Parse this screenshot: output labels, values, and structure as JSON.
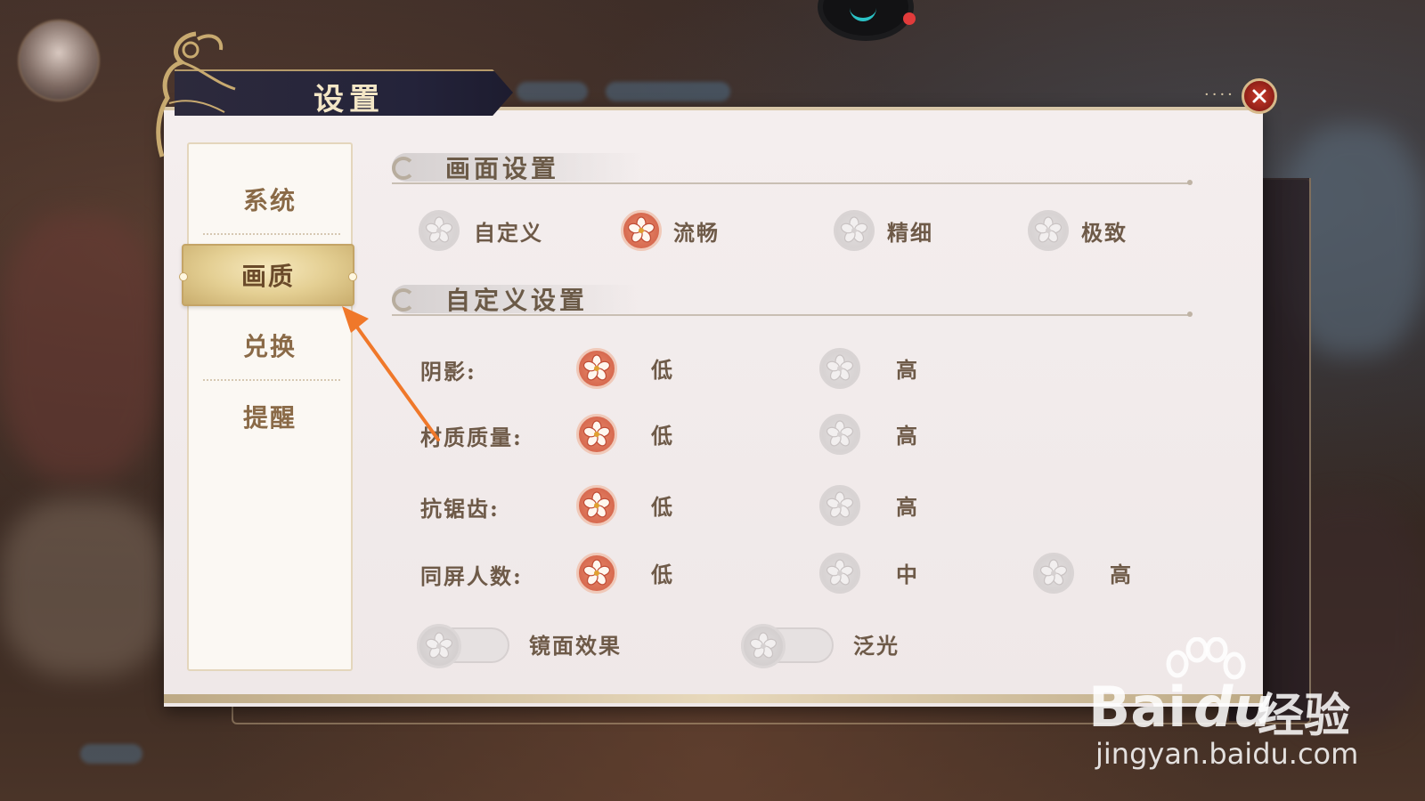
{
  "window": {
    "title": "设置",
    "close_icon": "close-icon",
    "close_dots": "····"
  },
  "sidebar": {
    "items": [
      {
        "label": "系统",
        "active": false
      },
      {
        "label": "画质",
        "active": true
      },
      {
        "label": "兑换",
        "active": false
      },
      {
        "label": "提醒",
        "active": false
      }
    ]
  },
  "picture_settings": {
    "title": "画面设置",
    "options": [
      {
        "label": "自定义",
        "selected": false
      },
      {
        "label": "流畅",
        "selected": true
      },
      {
        "label": "精细",
        "selected": false
      },
      {
        "label": "极致",
        "selected": false
      }
    ]
  },
  "custom_settings": {
    "title": "自定义设置",
    "rows": [
      {
        "label": "阴影:",
        "options": [
          {
            "label": "低",
            "selected": true
          },
          {
            "label": "高",
            "selected": false
          }
        ]
      },
      {
        "label": "材质质量:",
        "options": [
          {
            "label": "低",
            "selected": true
          },
          {
            "label": "高",
            "selected": false
          }
        ]
      },
      {
        "label": "抗锯齿:",
        "options": [
          {
            "label": "低",
            "selected": true
          },
          {
            "label": "高",
            "selected": false
          }
        ]
      },
      {
        "label": "同屏人数:",
        "options": [
          {
            "label": "低",
            "selected": true
          },
          {
            "label": "中",
            "selected": false
          },
          {
            "label": "高",
            "selected": false
          }
        ]
      }
    ],
    "toggles": [
      {
        "label": "镜面效果",
        "on": false
      },
      {
        "label": "泛光",
        "on": false
      }
    ]
  },
  "watermark": {
    "brand": "Bai",
    "brand_du": "du",
    "brand_cn": "经验",
    "url": "jingyan.baidu.com"
  },
  "colors": {
    "accent_selected": "#cf5b43",
    "sidebar_active": "#e4cf93",
    "text_brown": "#6e5a48",
    "close_red": "#c93a2a",
    "annotation_arrow": "#f0782a"
  }
}
